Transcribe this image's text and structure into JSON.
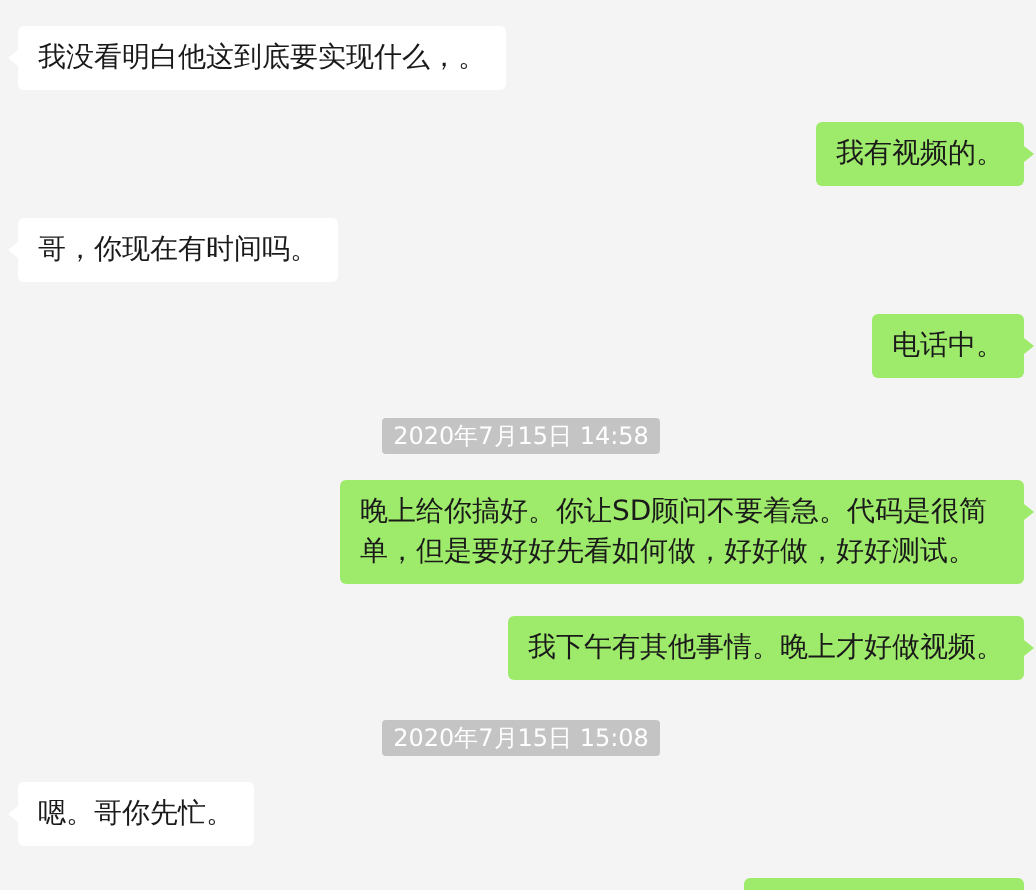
{
  "messages": [
    {
      "kind": "incoming",
      "text": "我没看明白他这到底要实现什么，。"
    },
    {
      "kind": "outgoing",
      "text": "我有视频的。"
    },
    {
      "kind": "incoming",
      "text": "哥，你现在有时间吗。"
    },
    {
      "kind": "outgoing",
      "text": "电话中。"
    },
    {
      "kind": "time",
      "text": "2020年7月15日 14:58"
    },
    {
      "kind": "outgoing",
      "text": "晚上给你搞好。你让SD顾问不要着急。代码是很简单，但是要好好先看如何做，好好做，好好测试。"
    },
    {
      "kind": "outgoing",
      "text": "我下午有其他事情。晚上才好做视频。"
    },
    {
      "kind": "time",
      "text": "2020年7月15日 15:08"
    },
    {
      "kind": "incoming",
      "text": "嗯。哥你先忙。"
    },
    {
      "kind": "outgoing"
    }
  ]
}
